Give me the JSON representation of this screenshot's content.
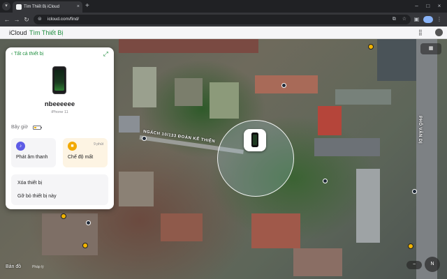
{
  "browser": {
    "tab_title": "Tìm Thiết Bị iCloud",
    "tab_close": "×",
    "new_tab": "+",
    "url": "icloud.com/find/",
    "tab_menu_icon": "chevron-down-icon",
    "favicon_glyph": "",
    "back_glyph": "←",
    "forward_glyph": "→",
    "reload_glyph": "↻",
    "site_info_glyph": "⊜",
    "window_minimize": "–",
    "window_maximize": "□",
    "window_close": "×"
  },
  "header": {
    "apple_glyph": "",
    "brand": "iCloud",
    "app_name": "Tìm Thiết Bị",
    "grid_icon": "app-grid-icon"
  },
  "panel": {
    "back_label": "‹ Tất cả thiết bị",
    "expand_glyph": "⤢",
    "device_name": "nbeeeeee",
    "device_model": "iPhone 11",
    "status_text": "Bây giờ",
    "battery_level": 0.35,
    "actions": {
      "sound_label": "Phát âm thanh",
      "sound_glyph": "♪",
      "lost_label": "Chế độ mất",
      "lost_meta": "9 phút",
      "lost_glyph": "■"
    },
    "erase_label": "Xóa thiết bị",
    "remove_label": "Gỡ bỏ thiết bị này"
  },
  "map": {
    "road_label": "NGÁCH 10/133 ĐOÀN KẾ THIỆN",
    "road_label_right": "PHỐ VĂN DỊ",
    "map_label": "Bản đồ",
    "legal": "Pháp lý",
    "zoom_out": "−",
    "compass": "N",
    "layers_glyph": "▦"
  },
  "colors": {
    "accent": "#1e8e3e",
    "sound_icon": "#5e5ce6",
    "lost_icon": "#f2a900"
  }
}
